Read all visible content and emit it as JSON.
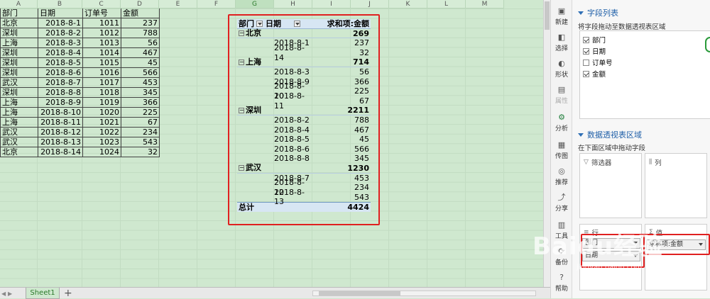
{
  "columns": [
    "A",
    "B",
    "C",
    "D",
    "E",
    "F",
    "G",
    "H",
    "I",
    "J",
    "K",
    "L",
    "M"
  ],
  "selected_column": "G",
  "source_table": {
    "headers": [
      "部门",
      "日期",
      "订单号",
      "金额"
    ],
    "rows": [
      [
        "北京",
        "2018-8-1",
        "1011",
        "237"
      ],
      [
        "深圳",
        "2018-8-2",
        "1012",
        "788"
      ],
      [
        "上海",
        "2018-8-3",
        "1013",
        "56"
      ],
      [
        "深圳",
        "2018-8-4",
        "1014",
        "467"
      ],
      [
        "深圳",
        "2018-8-5",
        "1015",
        "45"
      ],
      [
        "深圳",
        "2018-8-6",
        "1016",
        "566"
      ],
      [
        "武汉",
        "2018-8-7",
        "1017",
        "453"
      ],
      [
        "深圳",
        "2018-8-8",
        "1018",
        "345"
      ],
      [
        "上海",
        "2018-8-9",
        "1019",
        "366"
      ],
      [
        "上海",
        "2018-8-10",
        "1020",
        "225"
      ],
      [
        "上海",
        "2018-8-11",
        "1021",
        "67"
      ],
      [
        "武汉",
        "2018-8-12",
        "1022",
        "234"
      ],
      [
        "武汉",
        "2018-8-13",
        "1023",
        "543"
      ],
      [
        "北京",
        "2018-8-14",
        "1024",
        "32"
      ]
    ]
  },
  "pivot": {
    "header": {
      "dept": "部门",
      "date": "日期",
      "sum": "求和项:金额"
    },
    "groups": [
      {
        "name": "北京",
        "total": "269",
        "items": [
          [
            "2018-8-1",
            "237"
          ],
          [
            "2018-8-14",
            "32"
          ]
        ]
      },
      {
        "name": "上海",
        "total": "714",
        "items": [
          [
            "2018-8-3",
            "56"
          ],
          [
            "2018-8-9",
            "366"
          ],
          [
            "2018-8-10",
            "225"
          ],
          [
            "2018-8-11",
            "67"
          ]
        ]
      },
      {
        "name": "深圳",
        "total": "2211",
        "items": [
          [
            "2018-8-2",
            "788"
          ],
          [
            "2018-8-4",
            "467"
          ],
          [
            "2018-8-5",
            "45"
          ],
          [
            "2018-8-6",
            "566"
          ],
          [
            "2018-8-8",
            "345"
          ]
        ]
      },
      {
        "name": "武汉",
        "total": "1230",
        "items": [
          [
            "2018-8-7",
            "453"
          ],
          [
            "2018-8-12",
            "234"
          ],
          [
            "2018-8-13",
            "543"
          ]
        ]
      }
    ],
    "grand_total_label": "总计",
    "grand_total": "4424"
  },
  "sheet_tab": "Sheet1",
  "add_sheet": "+",
  "tools": [
    {
      "label": "新建",
      "icon": "new-icon"
    },
    {
      "label": "选择",
      "icon": "select-icon"
    },
    {
      "label": "形状",
      "icon": "shape-icon"
    },
    {
      "label": "属性",
      "icon": "property-icon"
    },
    {
      "label": "分析",
      "icon": "analyze-icon"
    },
    {
      "label": "传图",
      "icon": "image-icon"
    },
    {
      "label": "推荐",
      "icon": "recommend-icon"
    },
    {
      "label": "分享",
      "icon": "share-icon"
    },
    {
      "label": "工具",
      "icon": "tool-icon"
    },
    {
      "label": "备份",
      "icon": "backup-icon"
    },
    {
      "label": "帮助",
      "icon": "help-icon"
    }
  ],
  "panel": {
    "field_list_title": "字段列表",
    "field_list_hint": "将字段拖动至数据透视表区域",
    "fields": [
      {
        "label": "部门",
        "checked": true
      },
      {
        "label": "日期",
        "checked": true
      },
      {
        "label": "订单号",
        "checked": false
      },
      {
        "label": "金额",
        "checked": true
      }
    ],
    "area_title": "数据透视表区域",
    "area_hint": "在下面区域中拖动字段",
    "filter_label": "筛选器",
    "column_label": "列",
    "row_label": "行",
    "value_label": "值",
    "row_items": [
      "部门",
      "日期"
    ],
    "value_item": "求和项:金额"
  },
  "watermark": "Baidu经验",
  "watermark_sub": "jingyan.baidu.com"
}
